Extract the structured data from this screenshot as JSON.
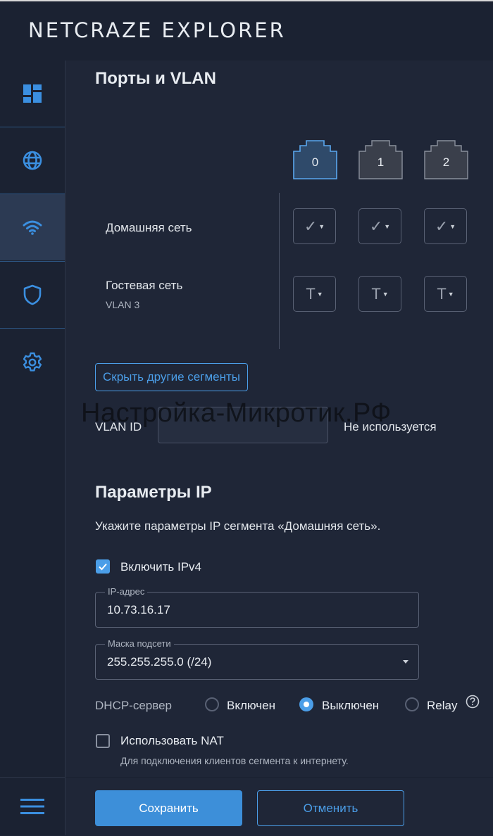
{
  "header": {
    "brand": "NETCRAZE EXPLORER"
  },
  "sidebar": {
    "items": [
      {
        "icon": "dashboard-icon"
      },
      {
        "icon": "globe-icon"
      },
      {
        "icon": "wifi-icon",
        "active": true
      },
      {
        "icon": "shield-icon"
      },
      {
        "icon": "gear-icon"
      }
    ],
    "menu_icon": "hamburger-icon"
  },
  "ports_section": {
    "title": "Порты и VLAN",
    "ports": [
      "0",
      "1",
      "2"
    ],
    "segments": [
      {
        "name": "Домашняя сеть",
        "sub": "",
        "mode": "✓"
      },
      {
        "name": "Гостевая сеть",
        "sub": "VLAN 3",
        "mode": "T"
      }
    ],
    "hide_button": "Скрыть другие сегменты",
    "vlan_label": "VLAN ID",
    "vlan_value": "",
    "vlan_note": "Не используется",
    "watermark": "Настройка-Микротик.РФ"
  },
  "ip_section": {
    "title": "Параметры IP",
    "description": "Укажите параметры IP сегмента «Домашняя сеть».",
    "enable_ipv4_label": "Включить IPv4",
    "ip_label": "IP-адрес",
    "ip_value": "10.73.16.17",
    "mask_label": "Маска подсети",
    "mask_value": "255.255.255.0 (/24)",
    "dhcp_label": "DHCP-сервер",
    "dhcp_options": [
      "Включен",
      "Выключен",
      "Relay"
    ],
    "nat_label": "Использовать NAT",
    "nat_hint": "Для подключения клиентов сегмента к интернету."
  },
  "footer": {
    "save": "Сохранить",
    "cancel": "Отменить"
  },
  "colors": {
    "accent": "#4b9ee8",
    "background": "#1f2637",
    "sidebar": "#1b2232"
  }
}
